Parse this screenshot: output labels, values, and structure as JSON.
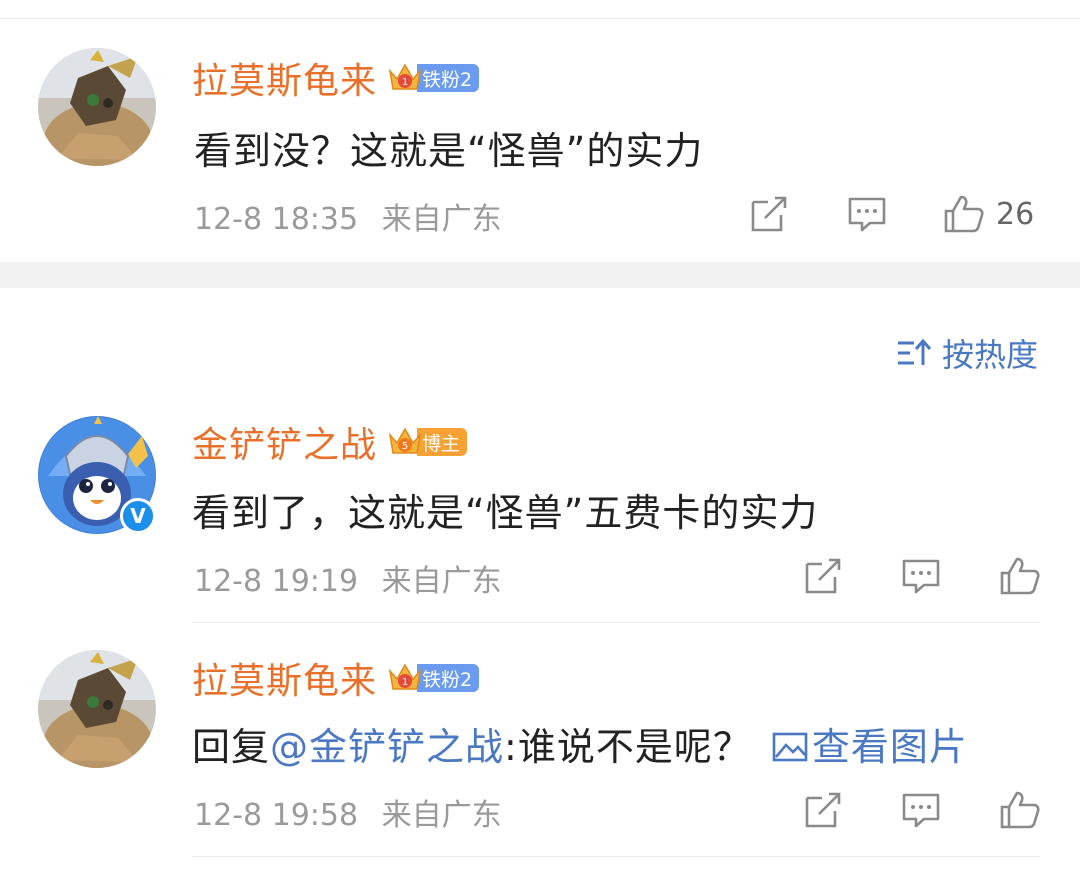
{
  "comments_top": [
    {
      "username": "拉莫斯龟来",
      "badge": "铁粉2",
      "badge_level": "1",
      "text": "看到没？这就是“怪兽”的实力",
      "time": "12-8 18:35",
      "location": "来自广东",
      "likes": "26"
    }
  ],
  "sort": {
    "label": "按热度",
    "icon": "sort-icon"
  },
  "comments": [
    {
      "username": "金铲铲之战",
      "badge": "博主",
      "badge_level": "5",
      "verified": "V",
      "text": "看到了，这就是“怪兽”五费卡的实力",
      "time": "12-8 19:19",
      "location": "来自广东"
    },
    {
      "username": "拉莫斯龟来",
      "badge": "铁粉2",
      "badge_level": "1",
      "reply_prefix": "回复",
      "mention": "@金铲铲之战",
      "text": ":谁说不是呢？",
      "image_link": "查看图片",
      "time": "12-8 19:58",
      "location": "来自广东"
    }
  ],
  "colors": {
    "username": "#e8702a",
    "link": "#4a78c2",
    "meta": "#9a9a9a",
    "badge_blue": "#6a9bee",
    "badge_orange": "#f5a133",
    "separator": "#f2f2f2"
  }
}
